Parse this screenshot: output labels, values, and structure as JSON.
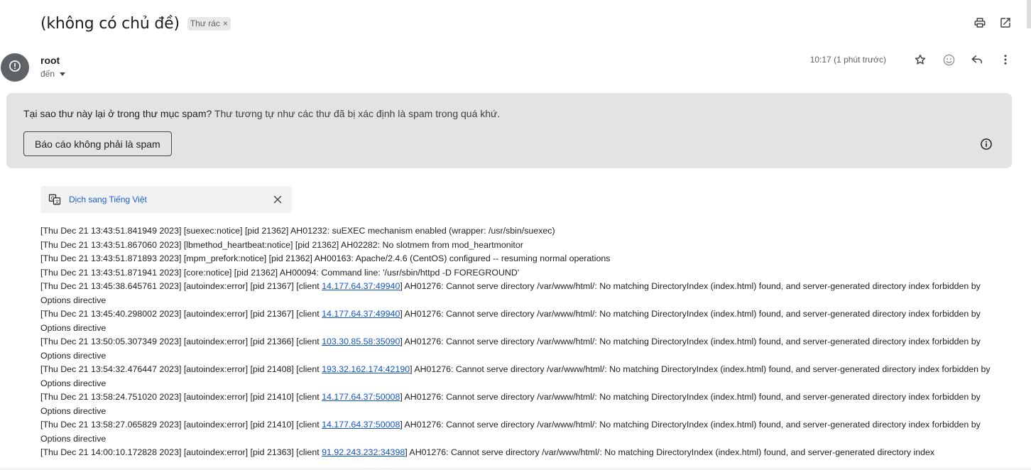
{
  "email": {
    "subject": "(không có chủ đề)",
    "label_chip": "Thư rác",
    "label_remove": "×",
    "sender_name": "root",
    "to_label": "đến",
    "timestamp": "10:17 (1 phút trước)"
  },
  "icons": {
    "print": "printer-icon",
    "open_new_window": "open-in-new-icon",
    "avatar": "exclamation-circle-icon",
    "star": "star-icon",
    "emoji": "emoji-icon",
    "reply": "reply-icon",
    "more": "more-vert-icon",
    "info": "info-icon",
    "translate": "translate-icon",
    "close": "close-icon"
  },
  "spam_banner": {
    "question": "Tại sao thư này lại ở trong thư mục spam?",
    "reason": " Thư tương tự như các thư đã bị xác định là spam trong quá khứ.",
    "button_label": "Báo cáo không phải là spam"
  },
  "translate": {
    "link_text": "Dịch sang Tiếng Việt"
  },
  "colors": {
    "banner_bg": "#e3e3e3",
    "link": "#1155cc",
    "avatar_bg": "#5f6368"
  },
  "log_lines": [
    {
      "pre": "[Thu Dec 21 13:43:51.841949 2023] [suexec:notice] [pid 21362] AH01232: suEXEC mechanism enabled (wrapper: /usr/sbin/suexec)",
      "link": "",
      "post": ""
    },
    {
      "pre": "[Thu Dec 21 13:43:51.867060 2023] [lbmethod_heartbeat:notice] [pid 21362] AH02282: No slotmem from mod_heartmonitor",
      "link": "",
      "post": ""
    },
    {
      "pre": "[Thu Dec 21 13:43:51.871893 2023] [mpm_prefork:notice] [pid 21362] AH00163: Apache/2.4.6 (CentOS) configured -- resuming normal operations",
      "link": "",
      "post": ""
    },
    {
      "pre": "[Thu Dec 21 13:43:51.871941 2023] [core:notice] [pid 21362] AH00094: Command line: '/usr/sbin/httpd -D FOREGROUND'",
      "link": "",
      "post": ""
    },
    {
      "pre": "[Thu Dec 21 13:45:38.645761 2023] [autoindex:error] [pid 21367] [client ",
      "link": "14.177.64.37:49940",
      "post": "] AH01276: Cannot serve directory /var/www/html/: No matching DirectoryIndex (index.html) found, and server-generated directory index forbidden by Options directive"
    },
    {
      "pre": "[Thu Dec 21 13:45:40.298002 2023] [autoindex:error] [pid 21367] [client ",
      "link": "14.177.64.37:49940",
      "post": "] AH01276: Cannot serve directory /var/www/html/: No matching DirectoryIndex (index.html) found, and server-generated directory index forbidden by Options directive"
    },
    {
      "pre": "[Thu Dec 21 13:50:05.307349 2023] [autoindex:error] [pid 21366] [client ",
      "link": "103.30.85.58:35090",
      "post": "] AH01276: Cannot serve directory /var/www/html/: No matching DirectoryIndex (index.html) found, and server-generated directory index forbidden by Options directive"
    },
    {
      "pre": "[Thu Dec 21 13:54:32.476447 2023] [autoindex:error] [pid 21408] [client ",
      "link": "193.32.162.174:42190",
      "post": "] AH01276: Cannot serve directory /var/www/html/: No matching DirectoryIndex (index.html) found, and server-generated directory index forbidden by Options directive"
    },
    {
      "pre": "[Thu Dec 21 13:58:24.751020 2023] [autoindex:error] [pid 21410] [client ",
      "link": "14.177.64.37:50008",
      "post": "] AH01276: Cannot serve directory /var/www/html/: No matching DirectoryIndex (index.html) found, and server-generated directory index forbidden by Options directive"
    },
    {
      "pre": "[Thu Dec 21 13:58:27.065829 2023] [autoindex:error] [pid 21410] [client ",
      "link": "14.177.64.37:50008",
      "post": "] AH01276: Cannot serve directory /var/www/html/: No matching DirectoryIndex (index.html) found, and server-generated directory index forbidden by Options directive"
    },
    {
      "pre": "[Thu Dec 21 14:00:10.172828 2023] [autoindex:error] [pid 21363] [client ",
      "link": "91.92.243.232:34398",
      "post": "] AH01276: Cannot serve directory /var/www/html/: No matching DirectoryIndex (index.html) found, and server-generated directory index"
    }
  ]
}
